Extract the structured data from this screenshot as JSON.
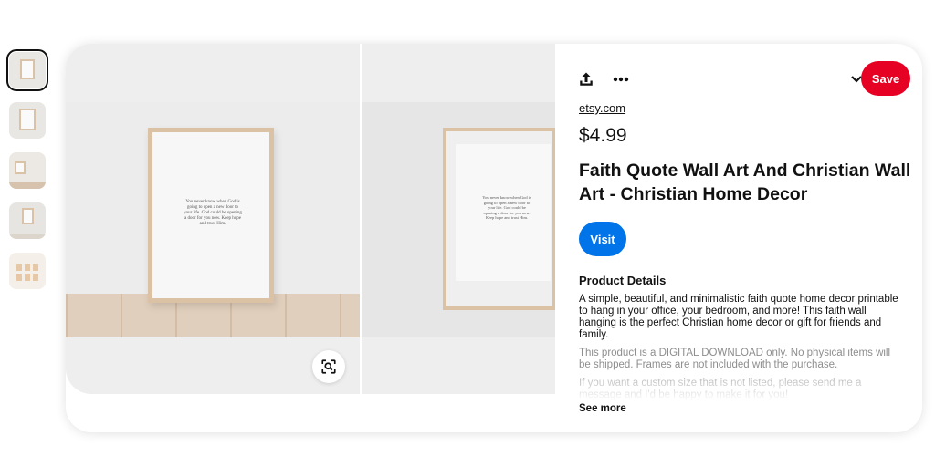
{
  "thumbnails": [
    {
      "id": "thumb-1",
      "active": true
    },
    {
      "id": "thumb-2",
      "active": false
    },
    {
      "id": "thumb-3",
      "active": false
    },
    {
      "id": "thumb-4",
      "active": false
    },
    {
      "id": "thumb-5",
      "active": false
    }
  ],
  "media": {
    "quote_text": "You never know when God is going to open a new door to your life. God could be opening a door for you now. Keep hope and trust Him.",
    "lens_icon": "visual-search-icon"
  },
  "toolbar": {
    "share_icon": "share-icon",
    "more_icon": "more-dots-icon",
    "dropdown_icon": "chevron-down-icon",
    "save_label": "Save"
  },
  "product": {
    "source": "etsy.com",
    "price": "$4.99",
    "title": "Faith Quote Wall Art And Christian Wall Art - Christian Home Decor",
    "visit_label": "Visit",
    "details_heading": "Product Details",
    "description": "A simple, beautiful, and minimalistic faith quote home decor printable to hang in your office, your bedroom, and more! This faith wall hanging is the perfect Christian home decor or gift for friends and family.",
    "description_2": "This product is a DIGITAL DOWNLOAD only. No physical items will be shipped. Frames are not included with the purchase.",
    "description_3": "If you want a custom size that is not listed, please send me a message and I'd be happy to make it for you!",
    "see_more_label": "See more"
  },
  "colors": {
    "save": "#e60023",
    "visit": "#0074e8",
    "frame_wood": "#dcc2a4"
  }
}
